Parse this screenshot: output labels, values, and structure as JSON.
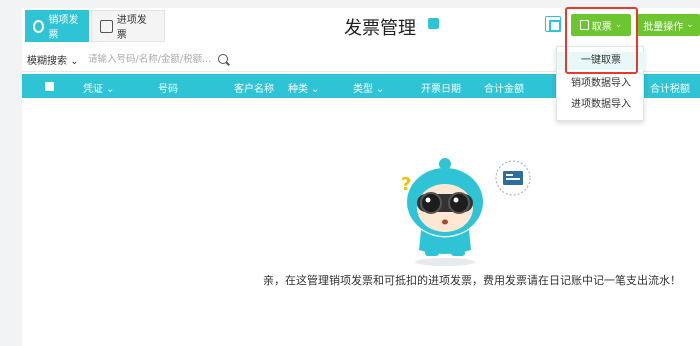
{
  "tabs": [
    {
      "label": "销项发票",
      "active": true
    },
    {
      "label": "进项发票",
      "active": false
    }
  ],
  "page_title": "发票管理",
  "toolbar": {
    "fetch_label": "取票",
    "batch_label": "批量操作"
  },
  "search": {
    "mode_label": "模糊搜索",
    "placeholder": "请输入号码/名称/金额/税额..."
  },
  "table": {
    "columns": [
      "凭证",
      "号码",
      "客户名称",
      "种类",
      "类型",
      "开票日期",
      "合计金额",
      "合计税额"
    ]
  },
  "fetch_menu": {
    "items": [
      "一键取票",
      "销项数据导入",
      "进项数据导入"
    ]
  },
  "empty_state": {
    "message": "亲，在这管理销项发票和可抵扣的进项发票，费用发票请在日记账中记一笔支出流水！"
  },
  "colors": {
    "accent": "#2ec4d5",
    "button_green": "#6dc62f",
    "highlight_red": "#e53a2f"
  }
}
